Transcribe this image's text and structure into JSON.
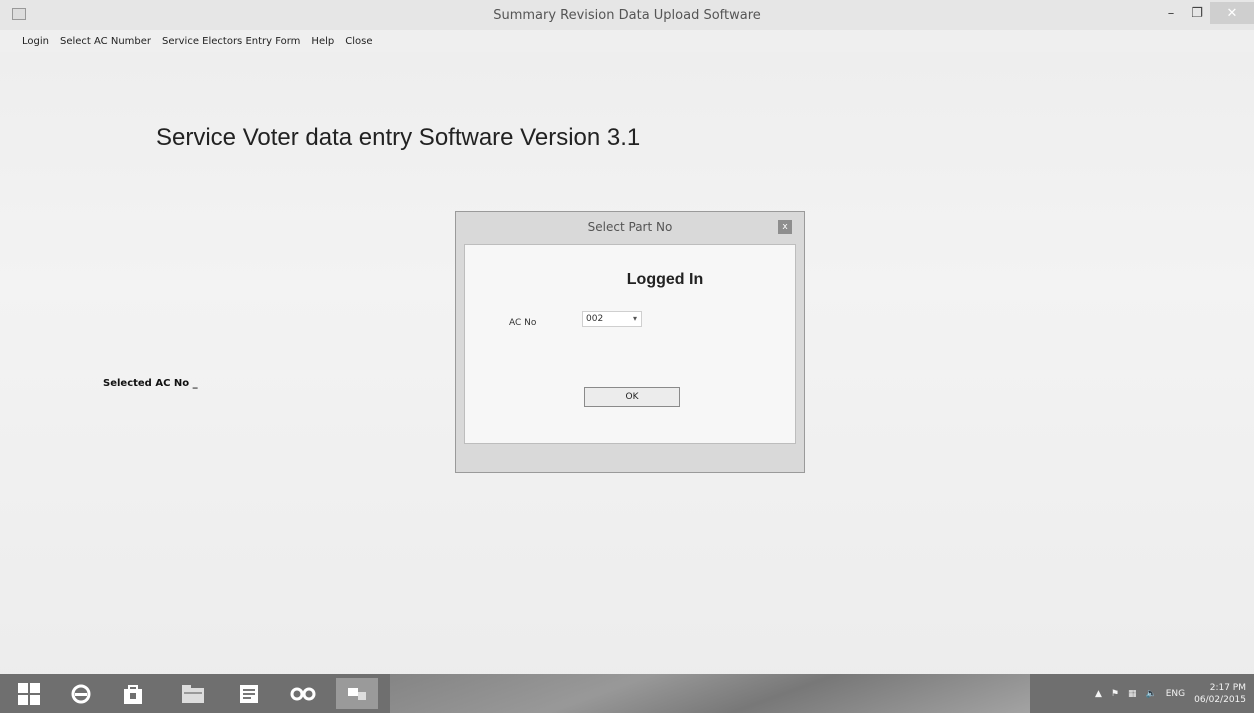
{
  "window": {
    "title": "Summary Revision Data Upload Software",
    "minimize": "–",
    "maximize": "❐",
    "close": "✕"
  },
  "menu": [
    {
      "label": "Login"
    },
    {
      "label": "Select AC Number"
    },
    {
      "label": "Service Electors Entry Form"
    },
    {
      "label": "Help"
    },
    {
      "label": "Close"
    }
  ],
  "main": {
    "heading": "Service Voter data entry Software Version 3.1",
    "selected_ac_label": "Selected AC No _"
  },
  "dialog": {
    "title": "Select Part No",
    "close": "x",
    "status": "Logged In",
    "ac_label": "AC No",
    "ac_value": "002",
    "ok_label": "OK"
  },
  "taskbar": {
    "icons": [
      "windows-start-icon",
      "internet-explorer-icon",
      "store-icon",
      "file-explorer-icon",
      "notepad-icon",
      "infinity-app-icon",
      "app-window-icon"
    ],
    "tray_lang": "ENG",
    "time": "2:17 PM",
    "date": "06/02/2015"
  }
}
